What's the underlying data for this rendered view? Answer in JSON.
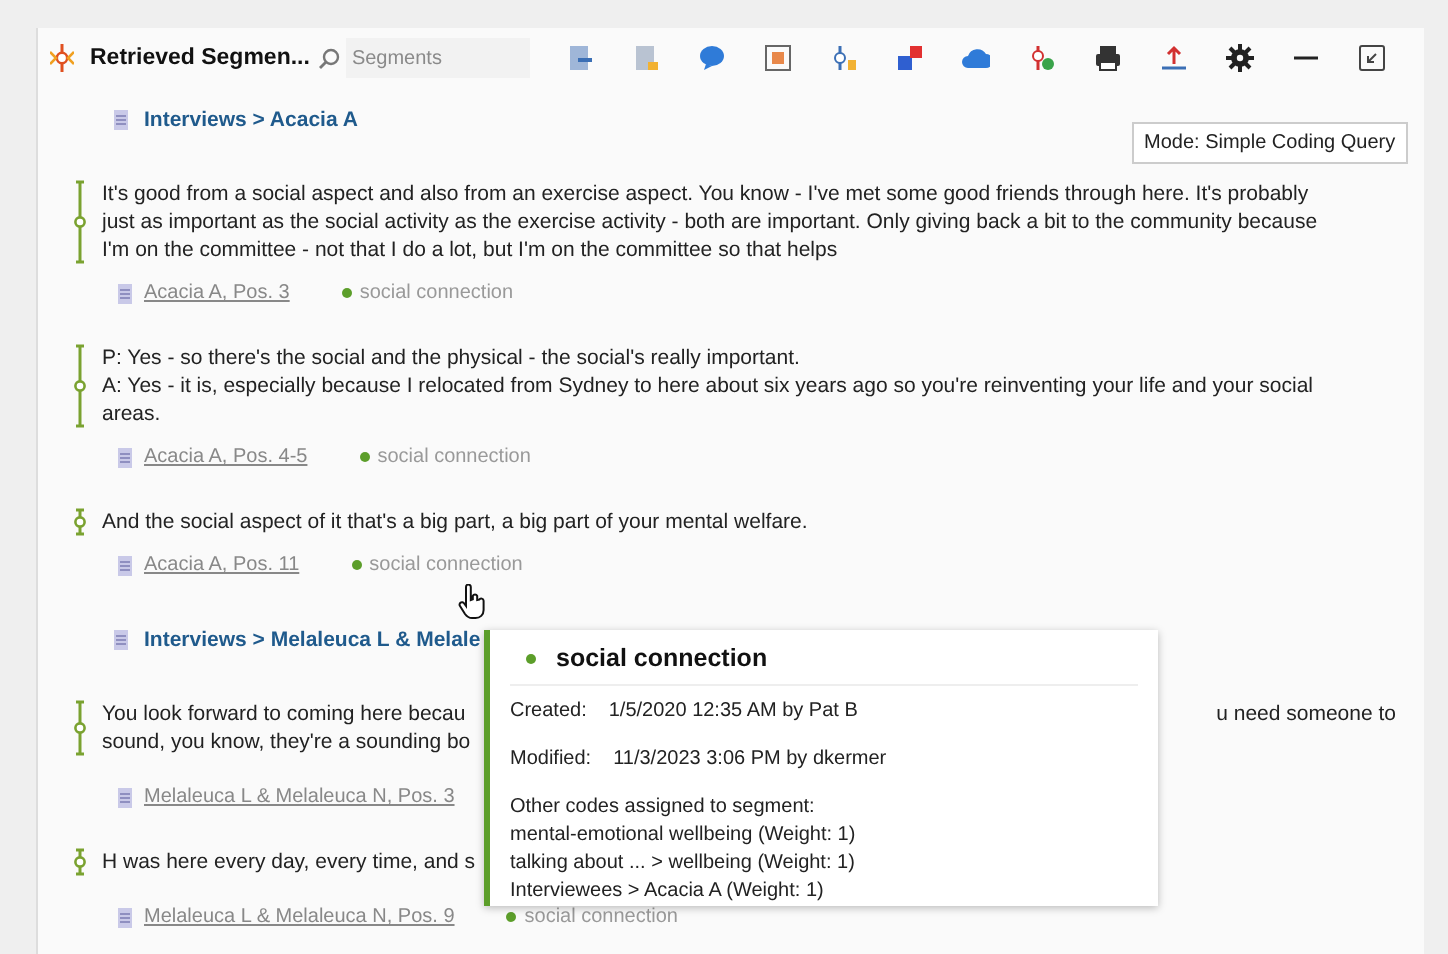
{
  "panel": {
    "title": "Retrieved Segmen...",
    "search": {
      "placeholder": "Segments"
    }
  },
  "tooltip": "Mode: Simple Coding Query",
  "groups": [
    {
      "heading": "Interviews > Acacia A",
      "segments": [
        {
          "lines": [
            {
              "left": "It's good from a social aspect and also from an exercise aspect. You know - I've met some good friends through here. It's probably"
            },
            {
              "left": "just as important as the social activity as the exercise activity - both are important. Only giving back a bit to the community because"
            },
            {
              "left": "I'm on the committee - not that I do a lot, but I'm on the committee so that helps"
            }
          ],
          "source": "Acacia A, Pos. 3",
          "code": {
            "name": "social connection",
            "color": "#5c9e2a"
          }
        },
        {
          "lines": [
            {
              "left": "P: Yes - so there's the social and the physical - the social's really important."
            },
            {
              "left": "A: Yes - it is, especially because I relocated from Sydney to here about six years ago so you're reinventing your life and your social"
            },
            {
              "left": "areas."
            }
          ],
          "source": "Acacia A, Pos. 4-5",
          "code": {
            "name": "social connection",
            "color": "#5c9e2a"
          }
        },
        {
          "lines": [
            {
              "left": "And the  social aspect of it that's a big part, a big part of your mental welfare."
            }
          ],
          "source": "Acacia A, Pos. 11",
          "code": {
            "name": "social connection",
            "color": "#5c9e2a"
          }
        }
      ]
    },
    {
      "heading": "Interviews > Melaleuca L & Melale",
      "segments": [
        {
          "lines": [
            {
              "left": "You look forward to coming here becau",
              "right": "u need someone to"
            },
            {
              "left": "sound, you know, they're a sounding bo"
            }
          ],
          "source": "Melaleuca L & Melaleuca N, Pos. 3"
        },
        {
          "lines": [
            {
              "left": "H was here every day, every time, and s"
            }
          ],
          "source": "Melaleuca L & Melaleuca N, Pos. 9",
          "code": {
            "name": "social connection",
            "color": "#5c9e2a"
          }
        }
      ]
    }
  ],
  "popup": {
    "code": "social connection",
    "color": "#5c9e2a",
    "fields": [
      {
        "label": "Created:",
        "value": "1/5/2020 12:35 AM by Pat B"
      },
      {
        "label": "Modified:",
        "value": "11/3/2023 3:06 PM by dkermer"
      }
    ],
    "other_title": "Other codes assigned to segment:",
    "other": [
      "mental-emotional wellbeing (Weight: 1)",
      "talking about ... > wellbeing (Weight: 1)",
      "Interviewees > Acacia A (Weight: 1)"
    ]
  }
}
